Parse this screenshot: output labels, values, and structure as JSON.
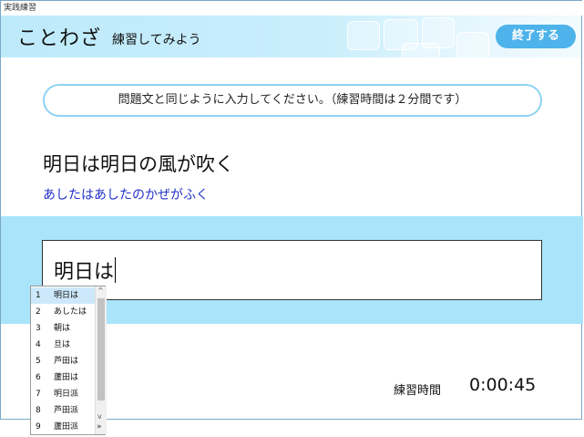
{
  "window": {
    "title": "実践練習"
  },
  "header": {
    "title": "ことわざ",
    "subtitle": "練習してみよう",
    "finish_label": "終了する"
  },
  "instruction": "問題文と同じように入力してください。（練習時間は２分間です）",
  "problem": {
    "text": "明日は明日の風が吹く",
    "reading": "あしたはあしたのかぜがふく"
  },
  "input": {
    "value": "明日は"
  },
  "timer": {
    "label": "練習時間",
    "value": "0:00:45"
  },
  "ime": {
    "candidates": [
      {
        "n": "1",
        "word": "明日は"
      },
      {
        "n": "2",
        "word": "あしたは"
      },
      {
        "n": "3",
        "word": "朝は"
      },
      {
        "n": "4",
        "word": "旦は"
      },
      {
        "n": "5",
        "word": "芦田は"
      },
      {
        "n": "6",
        "word": "蘆田は"
      },
      {
        "n": "7",
        "word": "明日派"
      },
      {
        "n": "8",
        "word": "芦田派"
      },
      {
        "n": "9",
        "word": "蘆田派"
      }
    ],
    "scroll_up": "^",
    "scroll_down": "v",
    "expand": "»"
  },
  "colors": {
    "accent": "#4db3ea",
    "band": "#a9e4fb",
    "reading": "#2230c8"
  }
}
